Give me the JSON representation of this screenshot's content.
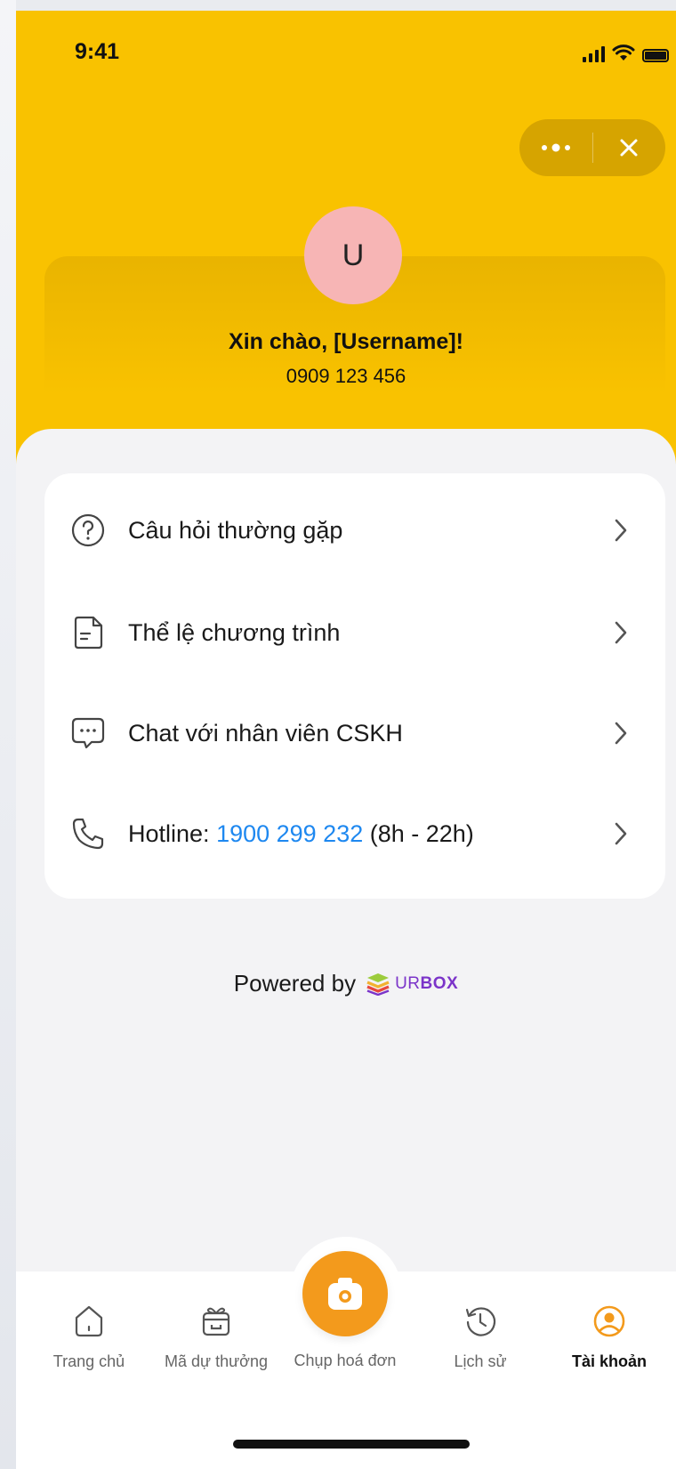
{
  "status_bar": {
    "time": "9:41"
  },
  "top_capsule": {
    "more_icon": "more-dots-icon",
    "close_icon": "close-icon"
  },
  "profile": {
    "avatar_initial": "U",
    "greeting": "Xin chào, [Username]!",
    "phone": "0909 123 456"
  },
  "menu": {
    "items": [
      {
        "label": "Câu hỏi thường gặp",
        "icon": "question-circle-icon"
      },
      {
        "label": "Thể lệ chương trình",
        "icon": "document-icon"
      },
      {
        "label": "Chat với nhân viên CSKH",
        "icon": "chat-bubble-icon"
      }
    ],
    "hotline": {
      "prefix": "Hotline: ",
      "number": "1900 299 232",
      "suffix": " (8h - 22h)",
      "icon": "phone-icon"
    }
  },
  "footer": {
    "powered_by": "Powered by",
    "brand_ur": "UR",
    "brand_box": "BOX"
  },
  "tabbar": {
    "tabs": [
      {
        "label": "Trang chủ",
        "icon": "home-icon"
      },
      {
        "label": "Mã dự thưởng",
        "icon": "gift-box-icon"
      },
      {
        "label": "Chụp hoá đơn",
        "icon": "camera-icon"
      },
      {
        "label": "Lịch sử",
        "icon": "history-icon"
      },
      {
        "label": "Tài khoản",
        "icon": "user-circle-icon"
      }
    ],
    "active": "Tài khoản"
  },
  "colors": {
    "header_yellow": "#f9c200",
    "accent_orange": "#f39a1c",
    "link_blue": "#1e88f0",
    "avatar_pink": "#f7b5b5",
    "brand_purple": "#7b34c9"
  }
}
